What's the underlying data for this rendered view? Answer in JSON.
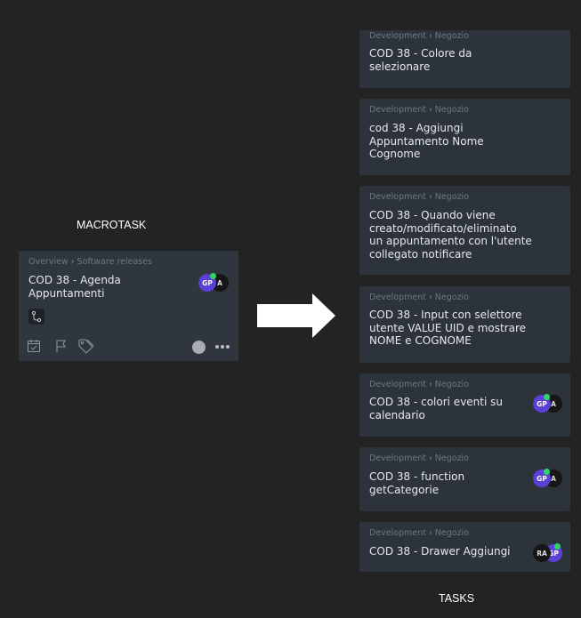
{
  "labels": {
    "macrotask": "MACROTASK",
    "tasks": "TASKS"
  },
  "macro_card": {
    "breadcrumb": [
      "Overview",
      "Software releases"
    ],
    "title": "COD 38 - Agenda\nAppuntamenti",
    "avatars": [
      "GP",
      "A"
    ]
  },
  "tasks": [
    {
      "breadcrumb": [
        "Development",
        "Negozio"
      ],
      "title": "COD 38 - Colore da\nselezionare",
      "avatars": []
    },
    {
      "breadcrumb": [
        "Development",
        "Negozio"
      ],
      "title": "cod 38 - Aggiungi\nAppuntamento Nome\nCognome",
      "avatars": []
    },
    {
      "breadcrumb": [
        "Development",
        "Negozio"
      ],
      "title": "COD 38 - Quando viene\ncreato/modificato/eliminato\nun appuntamento con l'utente\ncollegato notificare",
      "avatars": []
    },
    {
      "breadcrumb": [
        "Development",
        "Negozio"
      ],
      "title": "COD 38 - Input con selettore\nutente VALUE UID e mostrare\nNOME e COGNOME",
      "avatars": []
    },
    {
      "breadcrumb": [
        "Development",
        "Negozio"
      ],
      "title": "COD 38 - colori eventi su\ncalendario",
      "avatars": [
        "GP",
        "A"
      ]
    },
    {
      "breadcrumb": [
        "Development",
        "Negozio"
      ],
      "title": "COD 38 - function\ngetCategorie",
      "avatars": [
        "GP",
        "A"
      ]
    },
    {
      "breadcrumb": [
        "Development",
        "Negozio"
      ],
      "title": "COD 38 - Drawer Aggiungi",
      "avatars": [
        "RA",
        "GP"
      ]
    }
  ],
  "icons": {
    "subtask": "subtask-branch-icon",
    "calendar": "calendar-check-icon",
    "flag": "flag-icon",
    "tag": "tag-icon",
    "status": "status-circle-icon",
    "more": "more-dots-icon",
    "arrow": "right-arrow-icon"
  },
  "colors": {
    "background": "#232323",
    "card": "#2c333a",
    "avatar_purple": "#5b3fd6",
    "online_dot": "#2ed66a"
  }
}
